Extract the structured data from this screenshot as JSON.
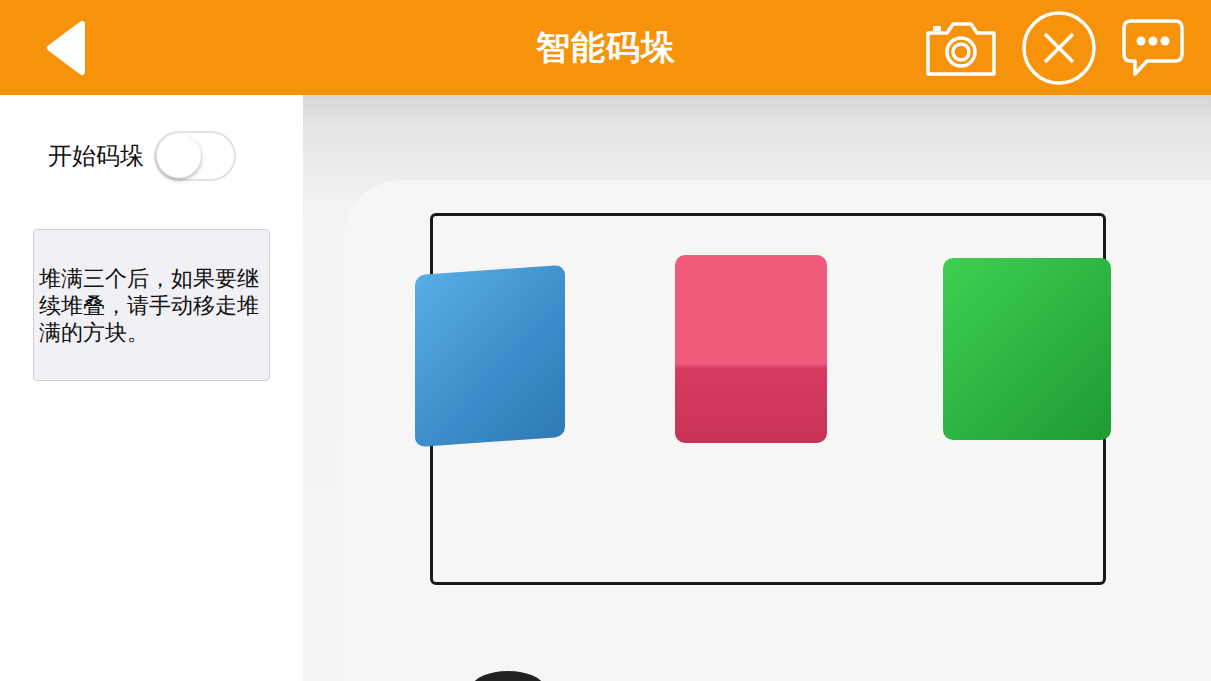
{
  "header": {
    "title": "智能码垛"
  },
  "stacking": {
    "label": "开始码垛",
    "on": false
  },
  "notice": "堆满三个后，如果要继续堆叠，请手动移走堆满的方块。"
}
